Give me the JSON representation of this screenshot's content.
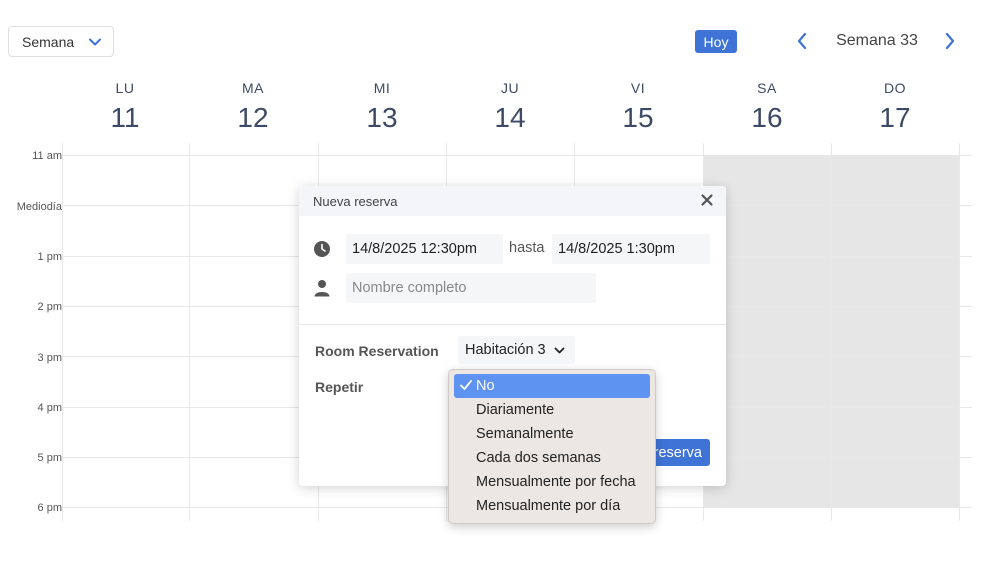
{
  "toolbar": {
    "view_select": "Semana",
    "today_label": "Hoy",
    "week_label": "Semana 33"
  },
  "days": [
    {
      "name": "LU",
      "num": "11"
    },
    {
      "name": "MA",
      "num": "12"
    },
    {
      "name": "MI",
      "num": "13"
    },
    {
      "name": "JU",
      "num": "14"
    },
    {
      "name": "VI",
      "num": "15"
    },
    {
      "name": "SA",
      "num": "16"
    },
    {
      "name": "DO",
      "num": "17"
    }
  ],
  "times": [
    "11 am",
    "Mediodía",
    "1 pm",
    "2 pm",
    "3 pm",
    "4 pm",
    "5 pm",
    "6 pm"
  ],
  "modal": {
    "title": "Nueva reserva",
    "start": "14/8/2025 12:30pm",
    "until_label": "hasta",
    "end": "14/8/2025 1:30pm",
    "name_placeholder": "Nombre completo",
    "room_label": "Room Reservation",
    "room_value": "Habitación 3",
    "repeat_label": "Repetir",
    "submit_label": "reserva"
  },
  "repeat_options": [
    "No",
    "Diariamente",
    "Semanalmente",
    "Cada dos semanas",
    "Mensualmente por fecha",
    "Mensualmente por día"
  ],
  "colors": {
    "accent": "#3f73d6",
    "dropdown_highlight": "#5e93f2",
    "weekend_shade": "#e6e6e6"
  }
}
